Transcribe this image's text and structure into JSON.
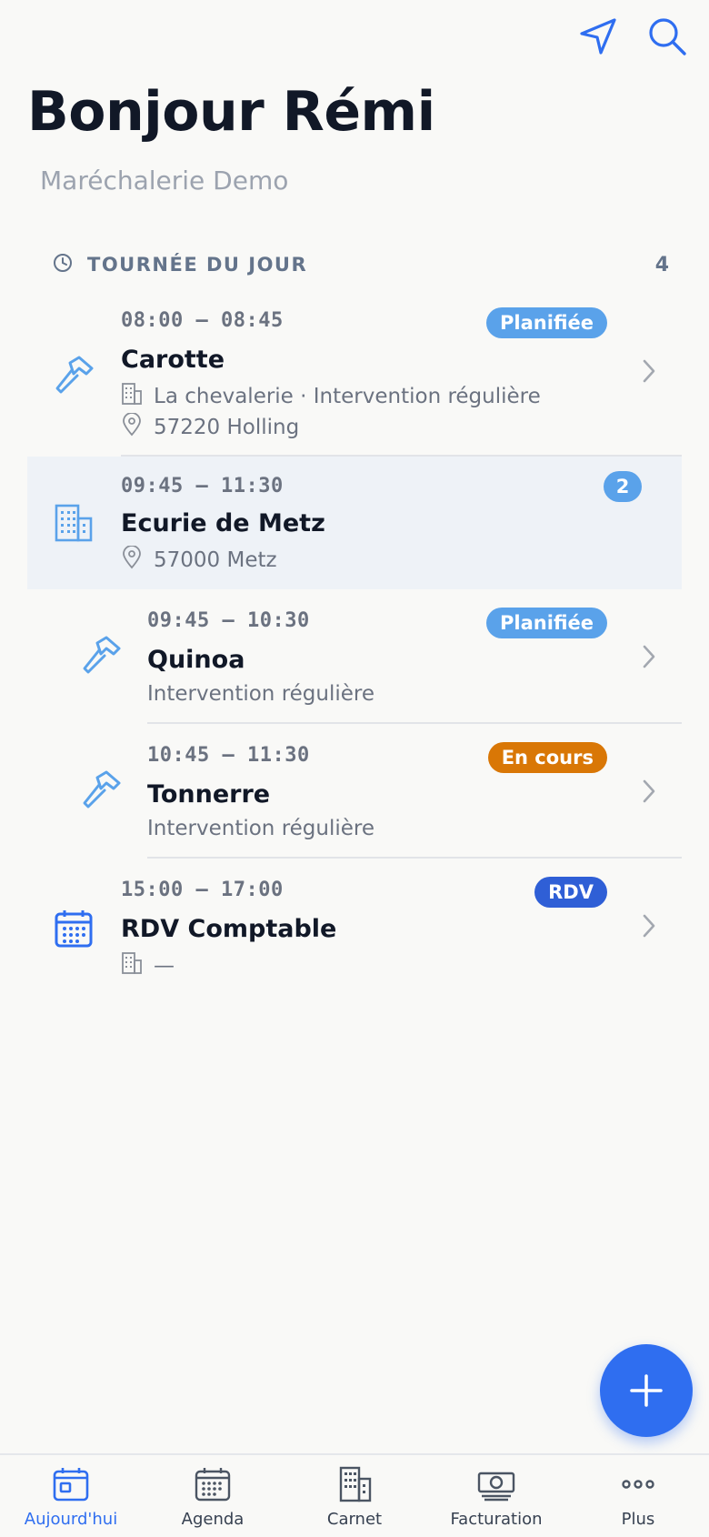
{
  "header": {
    "greeting": "Bonjour Rémi",
    "subtitle": "Maréchalerie Demo",
    "icons": [
      "navigation-arrow-icon",
      "search-icon"
    ]
  },
  "section": {
    "title": "TOURNÉE DU JOUR",
    "count": "4",
    "icon": "clock-icon"
  },
  "colors": {
    "accent": "#2f6ef0",
    "badge_planned": "#5aa2ea",
    "badge_inprogress": "#d97706",
    "badge_rdv": "#2f5fd6",
    "selected_row_bg": "#eef2f7"
  },
  "items": [
    {
      "time": "08:00 – 08:45",
      "name": "Carotte",
      "badge": "Planifiée",
      "line1": "La chevalerie · Intervention régulière",
      "line2": "57220 Holling",
      "icon": "hammer-icon"
    },
    {
      "time": "09:45 – 11:30",
      "name": "Ecurie de Metz",
      "badge": "2",
      "line1": "57000 Metz",
      "icon": "building-icon"
    },
    {
      "time": "09:45 – 10:30",
      "name": "Quinoa",
      "badge": "Planifiée",
      "line1": "Intervention régulière",
      "icon": "hammer-icon"
    },
    {
      "time": "10:45 – 11:30",
      "name": "Tonnerre",
      "badge": "En cours",
      "line1": "Intervention régulière",
      "icon": "hammer-icon"
    },
    {
      "time": "15:00 – 17:00",
      "name": "RDV Comptable",
      "badge": "RDV",
      "line1": "—",
      "icon": "calendar-icon"
    }
  ],
  "tabs": [
    {
      "label": "Aujourd'hui",
      "icon": "calendar-today-icon",
      "active": true
    },
    {
      "label": "Agenda",
      "icon": "calendar-grid-icon",
      "active": false
    },
    {
      "label": "Carnet",
      "icon": "building-icon",
      "active": false
    },
    {
      "label": "Facturation",
      "icon": "banknote-icon",
      "active": false
    },
    {
      "label": "Plus",
      "icon": "more-dots-icon",
      "active": false
    }
  ]
}
